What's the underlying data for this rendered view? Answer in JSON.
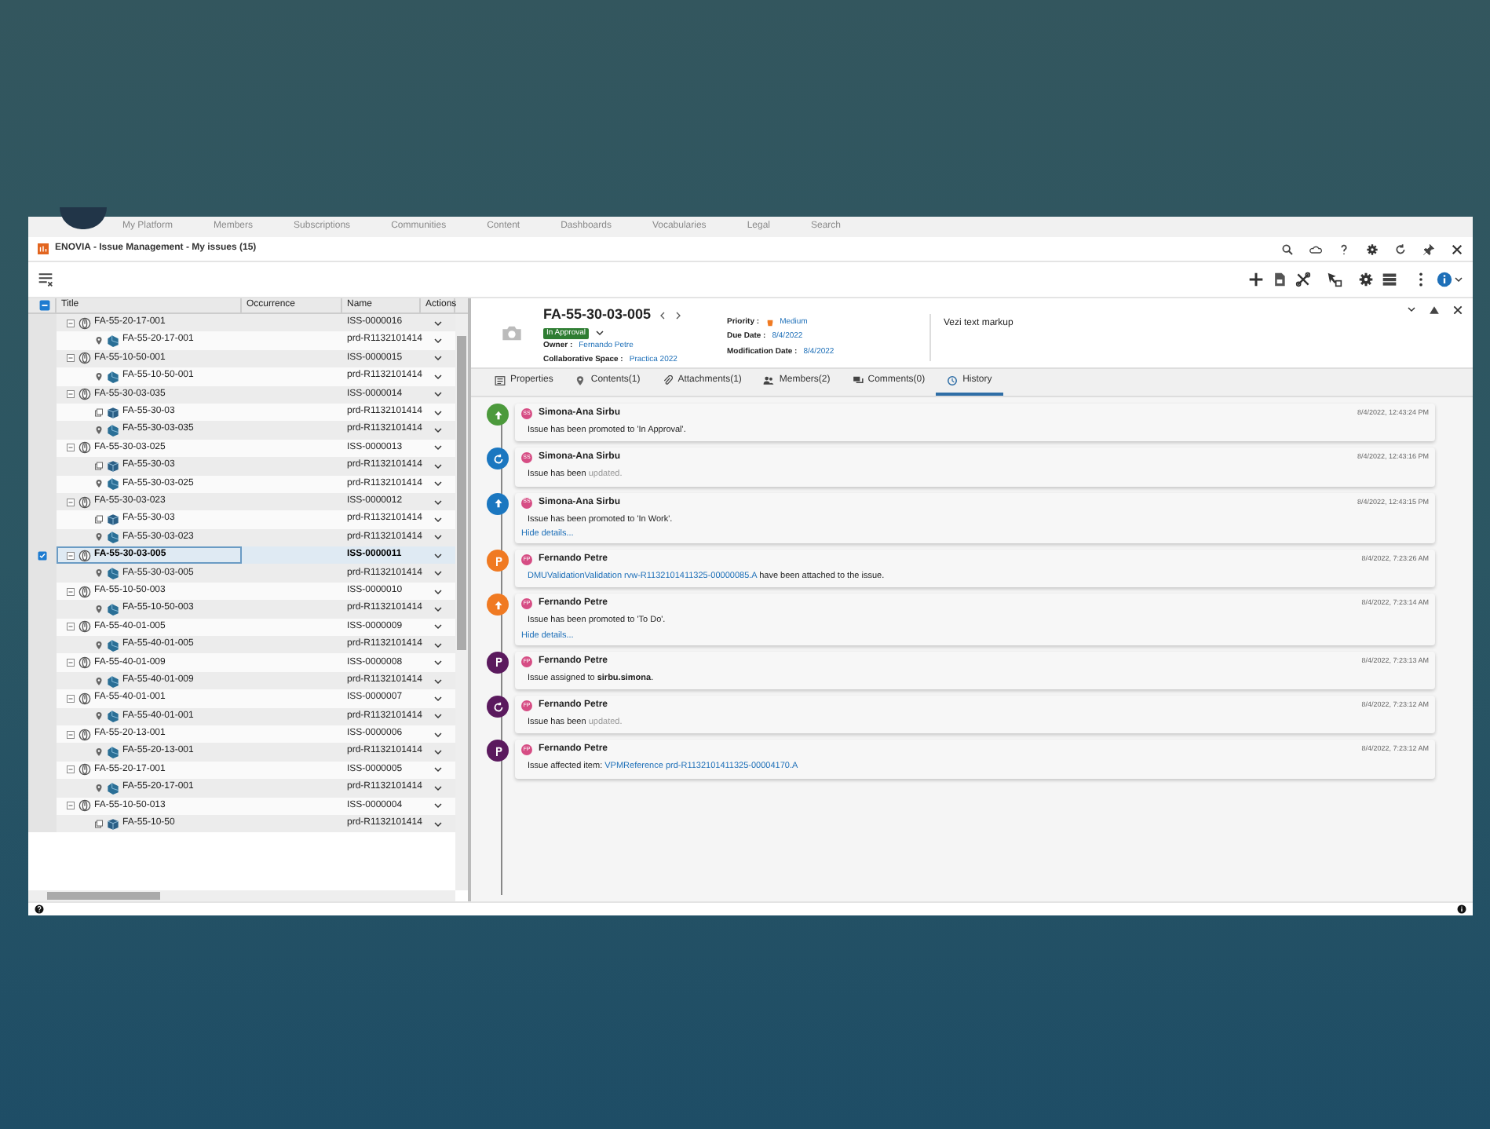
{
  "platform_nav": [
    "My Platform",
    "Members",
    "Subscriptions",
    "Communities",
    "Content",
    "Dashboards",
    "Vocabularies",
    "Legal",
    "Search"
  ],
  "app_title": "ENOVIA - Issue Management - My issues (15)",
  "table": {
    "select_all_partial": true,
    "columns": [
      "Title",
      "Occurrence",
      "Name",
      "Actions"
    ],
    "rows": [
      {
        "title": "FA-55-20-17-001",
        "name": "ISS-0000016",
        "selected": false,
        "children": [
          {
            "kind": "location",
            "title": "FA-55-20-17-001",
            "name": "prd-R1132101414"
          }
        ]
      },
      {
        "title": "FA-55-10-50-001",
        "name": "ISS-0000015",
        "selected": false,
        "children": [
          {
            "kind": "location",
            "title": "FA-55-10-50-001",
            "name": "prd-R1132101414"
          }
        ]
      },
      {
        "title": "FA-55-30-03-035",
        "name": "ISS-0000014",
        "selected": false,
        "children": [
          {
            "kind": "product",
            "title": "FA-55-30-03",
            "name": "prd-R1132101414"
          },
          {
            "kind": "location",
            "title": "FA-55-30-03-035",
            "name": "prd-R1132101414"
          }
        ]
      },
      {
        "title": "FA-55-30-03-025",
        "name": "ISS-0000013",
        "selected": false,
        "children": [
          {
            "kind": "product",
            "title": "FA-55-30-03",
            "name": "prd-R1132101414"
          },
          {
            "kind": "location",
            "title": "FA-55-30-03-025",
            "name": "prd-R1132101414"
          }
        ]
      },
      {
        "title": "FA-55-30-03-023",
        "name": "ISS-0000012",
        "selected": false,
        "children": [
          {
            "kind": "product",
            "title": "FA-55-30-03",
            "name": "prd-R1132101414"
          },
          {
            "kind": "location",
            "title": "FA-55-30-03-023",
            "name": "prd-R1132101414"
          }
        ]
      },
      {
        "title": "FA-55-30-03-005",
        "name": "ISS-0000011",
        "selected": true,
        "children": [
          {
            "kind": "location",
            "title": "FA-55-30-03-005",
            "name": "prd-R1132101414"
          }
        ]
      },
      {
        "title": "FA-55-10-50-003",
        "name": "ISS-0000010",
        "selected": false,
        "children": [
          {
            "kind": "location",
            "title": "FA-55-10-50-003",
            "name": "prd-R1132101414"
          }
        ]
      },
      {
        "title": "FA-55-40-01-005",
        "name": "ISS-0000009",
        "selected": false,
        "children": [
          {
            "kind": "location",
            "title": "FA-55-40-01-005",
            "name": "prd-R1132101414"
          }
        ]
      },
      {
        "title": "FA-55-40-01-009",
        "name": "ISS-0000008",
        "selected": false,
        "children": [
          {
            "kind": "location",
            "title": "FA-55-40-01-009",
            "name": "prd-R1132101414"
          }
        ]
      },
      {
        "title": "FA-55-40-01-001",
        "name": "ISS-0000007",
        "selected": false,
        "children": [
          {
            "kind": "location",
            "title": "FA-55-40-01-001",
            "name": "prd-R1132101414"
          }
        ]
      },
      {
        "title": "FA-55-20-13-001",
        "name": "ISS-0000006",
        "selected": false,
        "children": [
          {
            "kind": "location",
            "title": "FA-55-20-13-001",
            "name": "prd-R1132101414"
          }
        ]
      },
      {
        "title": "FA-55-20-17-001",
        "name": "ISS-0000005",
        "selected": false,
        "children": [
          {
            "kind": "location",
            "title": "FA-55-20-17-001",
            "name": "prd-R1132101414"
          }
        ]
      },
      {
        "title": "FA-55-10-50-013",
        "name": "ISS-0000004",
        "selected": false,
        "children": [
          {
            "kind": "product",
            "title": "FA-55-10-50",
            "name": "prd-R1132101414"
          }
        ]
      }
    ]
  },
  "issue": {
    "title": "FA-55-30-03-005",
    "status": "In Approval",
    "fields_left": [
      {
        "label": "Owner :",
        "value": "Fernando Petre"
      },
      {
        "label": "Collaborative Space :",
        "value": "Practica 2022"
      }
    ],
    "fields_right": [
      {
        "label": "Priority :",
        "value": "Medium"
      },
      {
        "label": "Due Date :",
        "value": "8/4/2022"
      },
      {
        "label": "Modification Date :",
        "value": "8/4/2022"
      }
    ],
    "description": "Vezi text markup"
  },
  "tabs": [
    {
      "label": "Properties",
      "selected": false
    },
    {
      "label": "Contents(1)",
      "selected": false
    },
    {
      "label": "Attachments(1)",
      "selected": false
    },
    {
      "label": "Members(2)",
      "selected": false
    },
    {
      "label": "Comments(0)",
      "selected": false
    },
    {
      "label": "History",
      "selected": true
    }
  ],
  "history": [
    {
      "kind": "promote",
      "color": "#4c9a3c",
      "initials": "SS",
      "author": "Simona-Ana Sirbu",
      "time": "8/4/2022, 12:43:24 PM",
      "parts": [
        {
          "kind": "plain",
          "text": "Issue has been promoted to 'In Approval'."
        }
      ]
    },
    {
      "kind": "update",
      "color": "#1b77c0",
      "initials": "SS",
      "author": "Simona-Ana Sirbu",
      "time": "8/4/2022, 12:43:16 PM",
      "parts": [
        {
          "kind": "plain",
          "text": "Issue has been "
        },
        {
          "kind": "muted",
          "text": "updated."
        }
      ]
    },
    {
      "kind": "promote",
      "color": "#1b77c0",
      "initials": "SS",
      "author": "Simona-Ana Sirbu",
      "time": "8/4/2022, 12:43:15 PM",
      "parts": [
        {
          "kind": "plain",
          "text": "Issue has been promoted to 'In Work'."
        }
      ],
      "details": "Hide details..."
    },
    {
      "kind": "assign",
      "color": "#f07a22",
      "initials": "FP",
      "author": "Fernando Petre",
      "time": "8/4/2022, 7:23:26 AM",
      "parts": [
        {
          "kind": "link",
          "text": "DMUValidationValidation rvw-R1132101411325-00000085.A"
        },
        {
          "kind": "plain",
          "text": " have been attached to the issue."
        }
      ]
    },
    {
      "kind": "promote",
      "color": "#f07a22",
      "initials": "FP",
      "author": "Fernando Petre",
      "time": "8/4/2022, 7:23:14 AM",
      "parts": [
        {
          "kind": "plain",
          "text": "Issue has been promoted to 'To Do'."
        }
      ],
      "details": "Hide details..."
    },
    {
      "kind": "assign",
      "color": "#5b1a5e",
      "initials": "FP",
      "author": "Fernando Petre",
      "time": "8/4/2022, 7:23:13 AM",
      "parts": [
        {
          "kind": "plain",
          "text": "Issue assigned to "
        },
        {
          "kind": "bold",
          "text": "sirbu.simona"
        },
        {
          "kind": "plain",
          "text": "."
        }
      ]
    },
    {
      "kind": "update",
      "color": "#5b1a5e",
      "initials": "FP",
      "author": "Fernando Petre",
      "time": "8/4/2022, 7:23:12 AM",
      "parts": [
        {
          "kind": "plain",
          "text": "Issue has been "
        },
        {
          "kind": "muted",
          "text": "updated."
        }
      ]
    },
    {
      "kind": "assign",
      "color": "#5b1a5e",
      "initials": "FP",
      "author": "Fernando Petre",
      "time": "8/4/2022, 7:23:12 AM",
      "parts": [
        {
          "kind": "plain",
          "text": "Issue affected item: "
        },
        {
          "kind": "link",
          "text": "VPMReference prd-R1132101411325-00004170.A"
        }
      ]
    }
  ]
}
